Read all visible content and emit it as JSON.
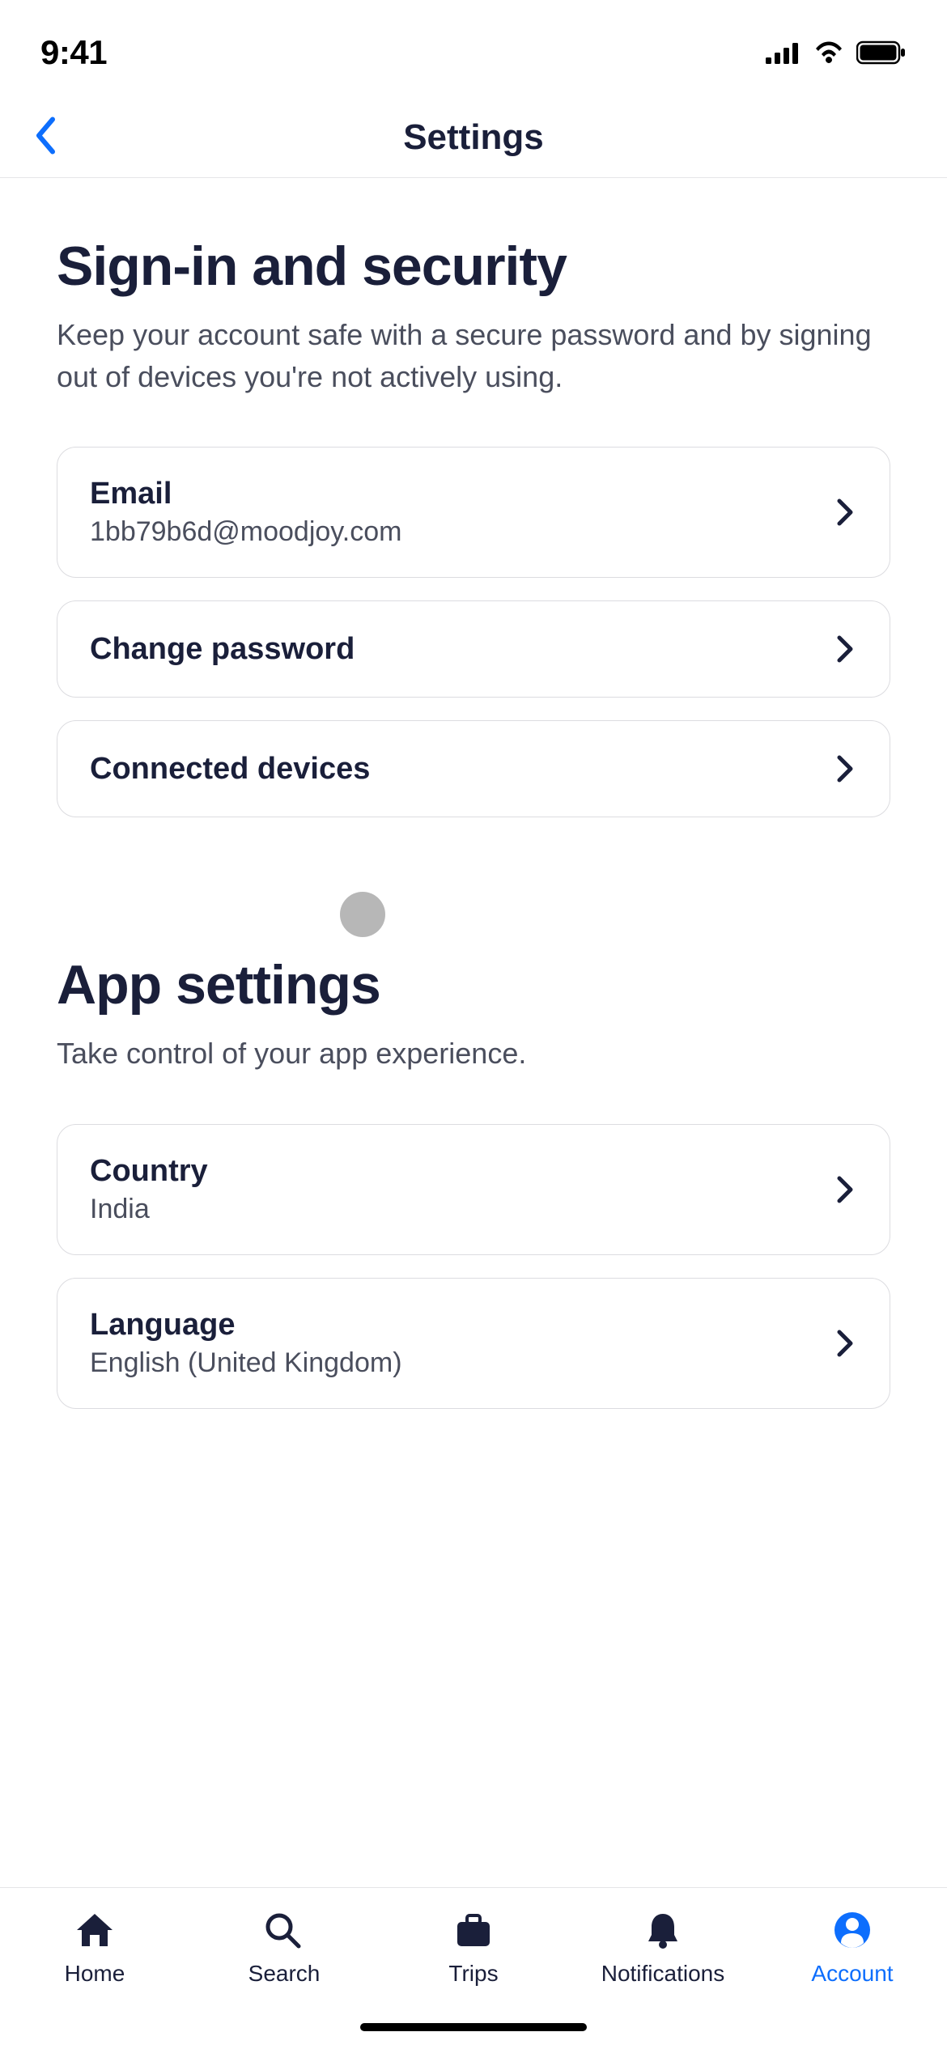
{
  "statusBar": {
    "time": "9:41"
  },
  "header": {
    "title": "Settings"
  },
  "sections": {
    "security": {
      "title": "Sign-in and security",
      "subtitle": "Keep your account safe with a secure password and by signing out of devices you're not actively using."
    },
    "app": {
      "title": "App settings",
      "subtitle": "Take control of your app experience."
    }
  },
  "rows": {
    "email": {
      "label": "Email",
      "value": "1bb79b6d@moodjoy.com"
    },
    "password": {
      "label": "Change password"
    },
    "devices": {
      "label": "Connected devices"
    },
    "country": {
      "label": "Country",
      "value": "India"
    },
    "language": {
      "label": "Language",
      "value": "English (United Kingdom)"
    }
  },
  "tabs": {
    "home": "Home",
    "search": "Search",
    "trips": "Trips",
    "notifications": "Notifications",
    "account": "Account"
  }
}
